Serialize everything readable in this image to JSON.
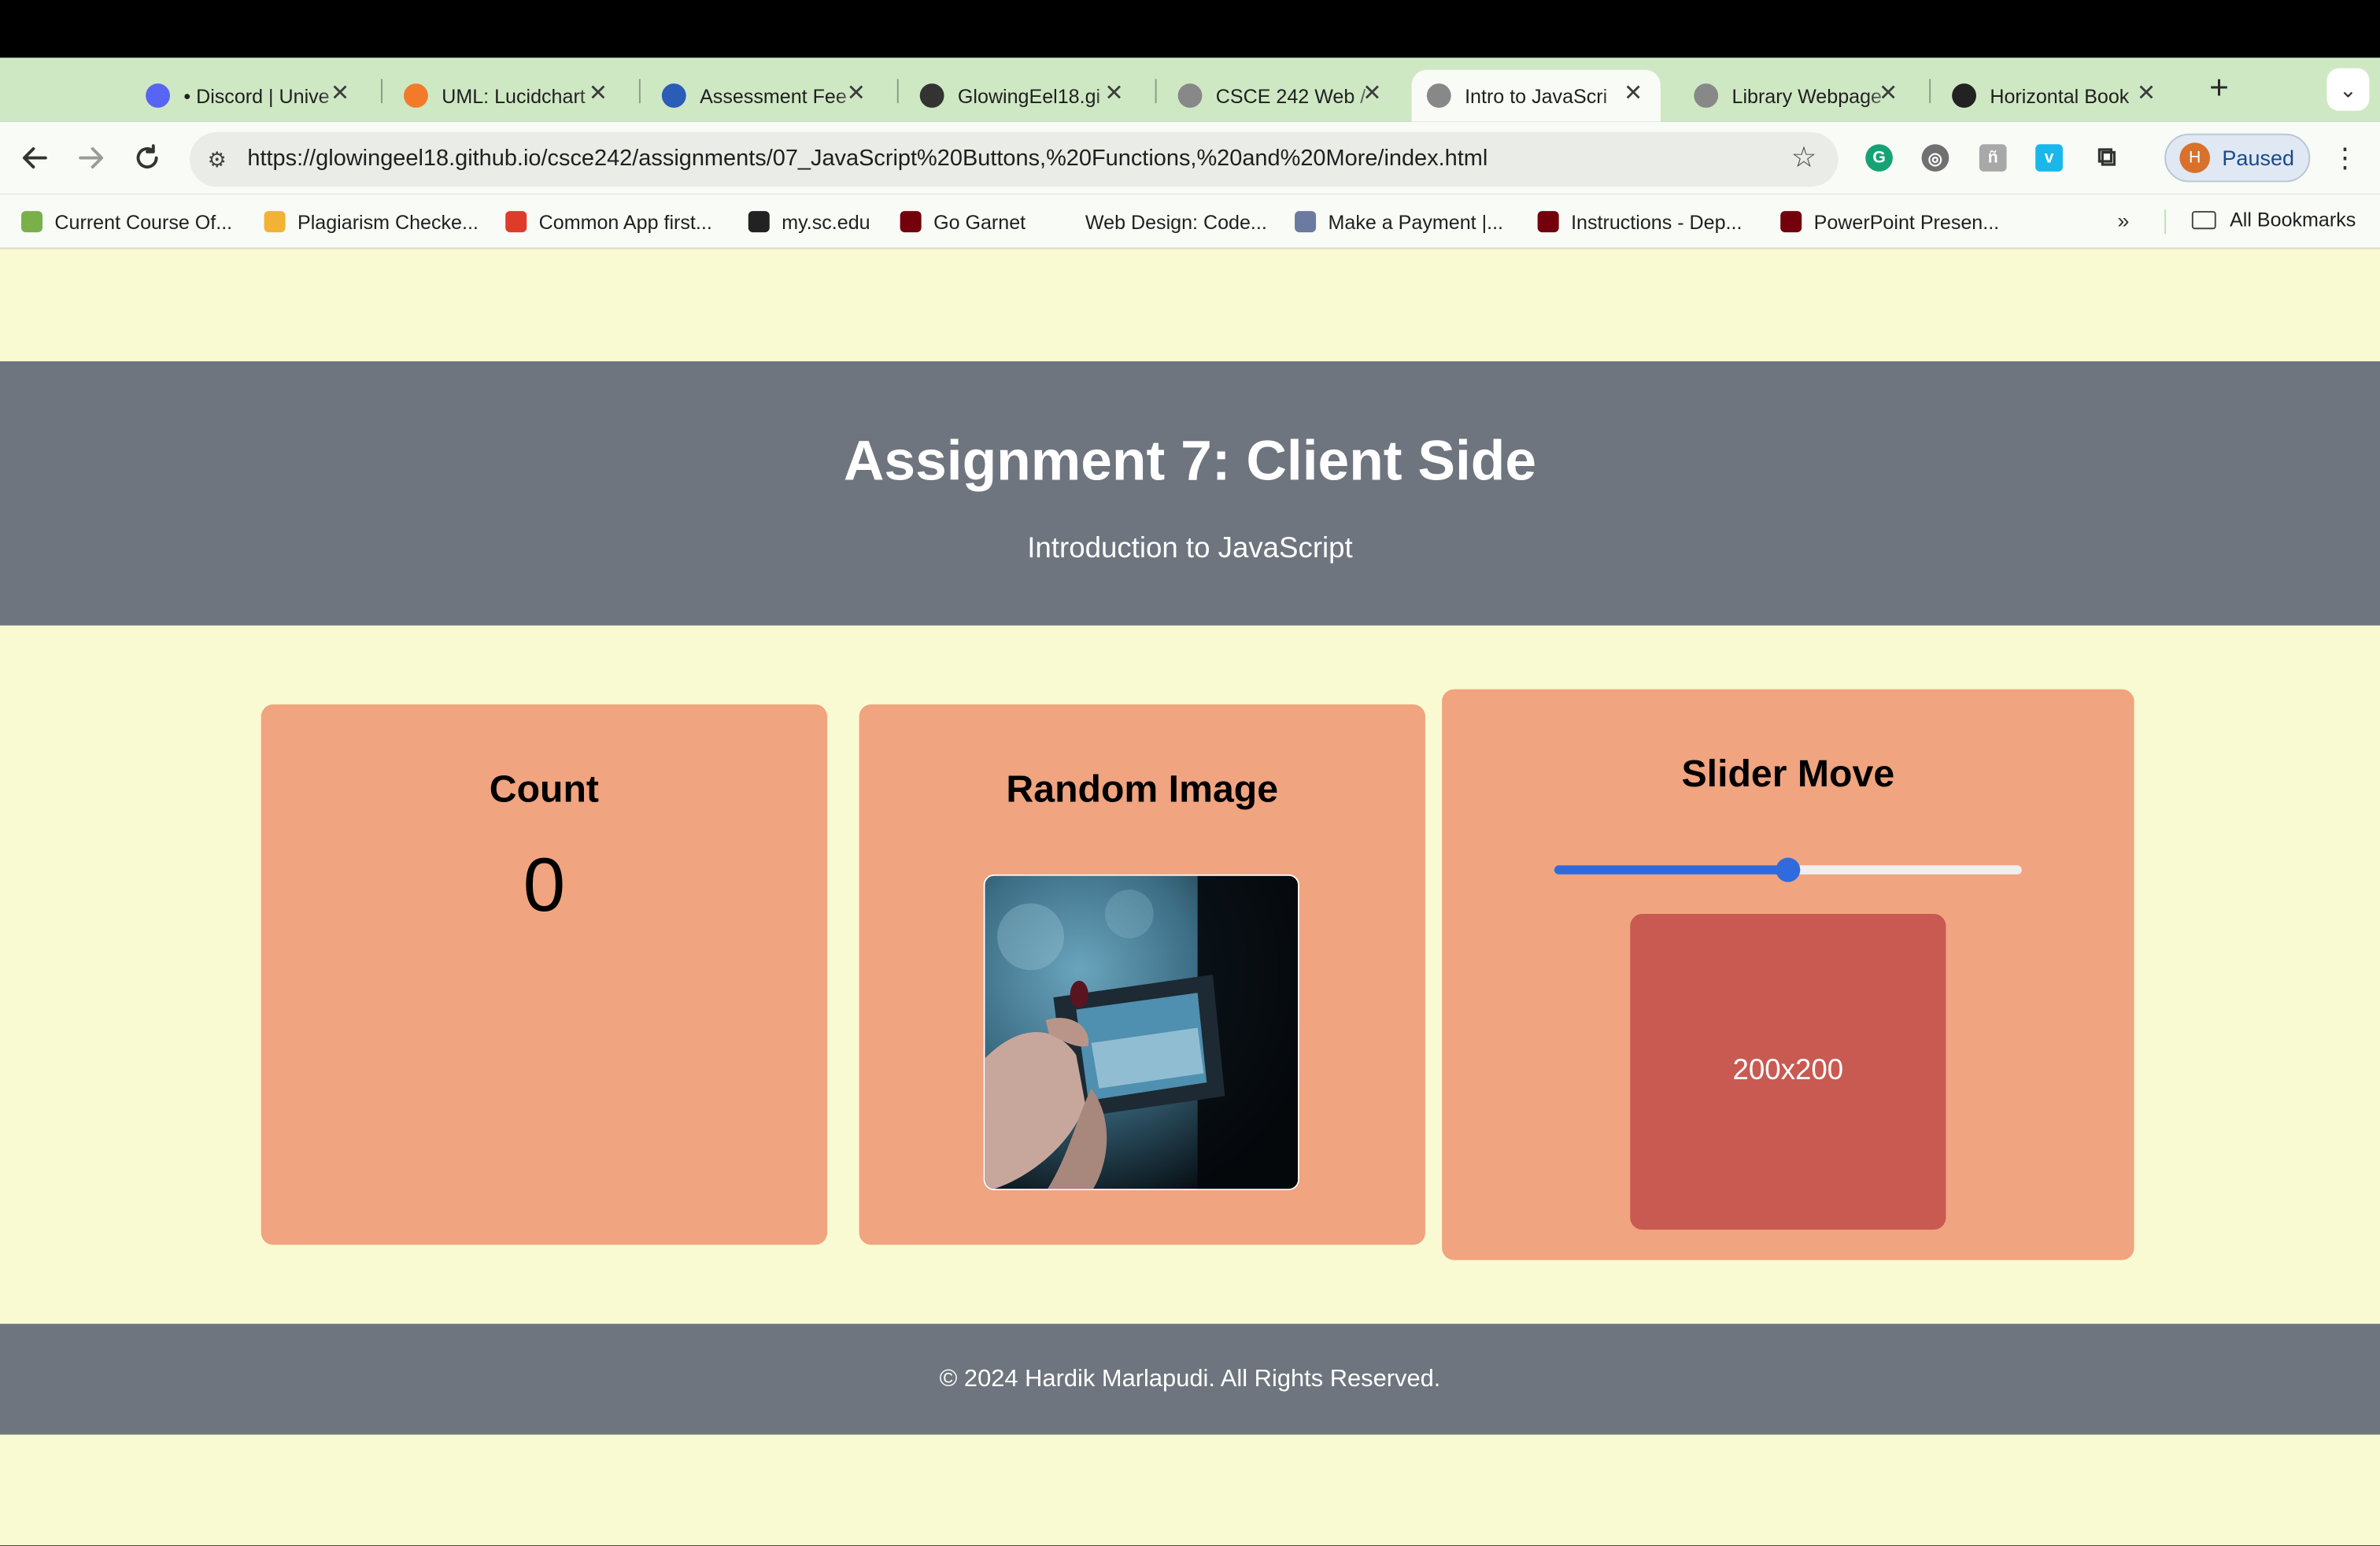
{
  "browser": {
    "tabs": [
      {
        "title": "• Discord | Unive",
        "icon_color": "#5865f2"
      },
      {
        "title": "UML: Lucidchart",
        "icon_color": "#f27a2a"
      },
      {
        "title": "Assessment Fee",
        "icon_color": "#2b5cb8"
      },
      {
        "title": "GlowingEel18.gi",
        "icon_color": "#333333"
      },
      {
        "title": "CSCE 242 Web /",
        "icon_color": "#888888"
      },
      {
        "title": "Intro to JavaScri",
        "icon_color": "#888888"
      },
      {
        "title": "Library Webpage",
        "icon_color": "#888888"
      },
      {
        "title": "Horizontal Book",
        "icon_color": "#222222"
      }
    ],
    "active_tab_index": 5,
    "new_tab_icon": "+",
    "tab_menu_icon": "⌄",
    "url": "https://glowingeel18.github.io/csce242/assignments/07_JavaScript%20Buttons,%20Functions,%20and%20More/index.html",
    "profile": {
      "initial": "H",
      "label": "Paused"
    },
    "bookmarks": [
      {
        "label": "Current Course Of...",
        "icon_color": "#7ab04a"
      },
      {
        "label": "Plagiarism Checke...",
        "icon_color": "#f2b233"
      },
      {
        "label": "Common App first...",
        "icon_color": "#e03a2a"
      },
      {
        "label": "my.sc.edu",
        "icon_color": "#222222"
      },
      {
        "label": "Go Garnet",
        "icon_color": "#73000a"
      },
      {
        "label": "Web Design: Code...",
        "icon_color": "#f8fbf6"
      },
      {
        "label": "Make a Payment |...",
        "icon_color": "#6a7aa0"
      },
      {
        "label": "Instructions - Dep...",
        "icon_color": "#73000a"
      },
      {
        "label": "PowerPoint Presen...",
        "icon_color": "#73000a"
      }
    ],
    "bookmarks_overflow": "»",
    "all_bookmarks": "All Bookmarks"
  },
  "page": {
    "title": "Assignment 7: Client Side",
    "subtitle": "Introduction to JavaScript",
    "count_card": {
      "heading": "Count",
      "value": "0"
    },
    "image_card": {
      "heading": "Random Image"
    },
    "slider_card": {
      "heading": "Slider Move",
      "slider_value": 0.5,
      "box_label": "200x200"
    },
    "footer": "© 2024 Hardik Marlapudi. All Rights Reserved."
  },
  "colors": {
    "page_bg": "#fafad2",
    "header_bg": "#6e757e",
    "card_bg": "#f0a47f",
    "square_bg": "#c85a52",
    "slider_accent": "#2f6bdd"
  }
}
